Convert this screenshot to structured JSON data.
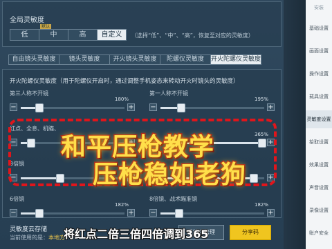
{
  "global": {
    "title": "全局灵敏度",
    "badge": "默认",
    "options": [
      "低",
      "中",
      "高",
      "自定义"
    ],
    "active_option": "自定义",
    "hint": "（选择“低”、“中”、“高”，恢复至对应的灵敏度）"
  },
  "tabs": [
    {
      "label": "自由镜头灵敏度",
      "active": false
    },
    {
      "label": "镜头灵敏度",
      "active": false
    },
    {
      "label": "开火镜头灵敏度",
      "active": false
    },
    {
      "label": "陀螺仪灵敏度",
      "active": false
    },
    {
      "label": "开火陀螺仪灵敏度",
      "active": true
    }
  ],
  "gyro_section": {
    "description": "开火陀螺仪灵敏度（用于陀螺仪开启时，通过调整手机姿态来转动开火时镜头的灵敏度）"
  },
  "sliders": [
    {
      "label": "第三人称不开镜",
      "value": "180%",
      "level": 0.18
    },
    {
      "label": "第一人称不开镜",
      "value": "195%",
      "level": 0.2
    },
    {
      "label": "红点、全息、机瞄、",
      "value": "",
      "level": 0.1
    },
    {
      "label": "",
      "value": "365%",
      "level": 0.98
    },
    {
      "label": "3倍镜",
      "value": "",
      "level": 0.38
    },
    {
      "label": "",
      "value": "",
      "level": 0.9
    },
    {
      "label": "6倍镜",
      "value": "182%",
      "level": 0.18
    },
    {
      "label": "8倍镜、战术瞄准镜",
      "value": "182%",
      "level": 0.18
    }
  ],
  "overlay": {
    "line1": "和平压枪教学",
    "line2": "压枪稳如老狗",
    "caption": "将红点二倍三倍四倍调到365"
  },
  "storage": {
    "title": "灵敏度云存储",
    "sub_prefix": "当前使用的是：",
    "sub_value": "本地方",
    "btn_manage": "灵敏度管理",
    "btn_share": "分享码"
  },
  "right_nav": {
    "top_label": "安装",
    "items": [
      "基础设置",
      "画面设置",
      "操作设置",
      "载具设置",
      "灵敏度设置",
      "拾取设置",
      "效果设置",
      "声音设置",
      "录像设置",
      "账户安全"
    ],
    "active": "灵敏度设置"
  }
}
